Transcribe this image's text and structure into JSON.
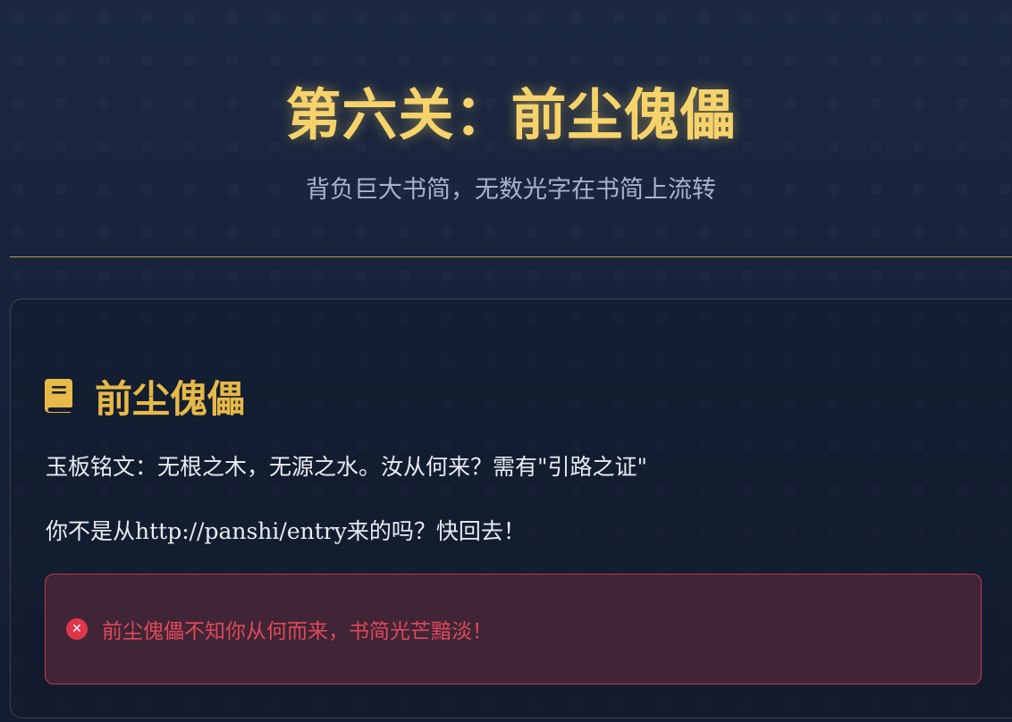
{
  "header": {
    "title": "第六关：前尘傀儡",
    "subtitle": "背负巨大书简，无数光字在书简上流转"
  },
  "card": {
    "icon": "book-icon",
    "title": "前尘傀儡",
    "inscription": "玉板铭文：无根之木，无源之水。汝从何来？需有\"引路之证\"",
    "hint": "你不是从http://panshi/entry来的吗？快回去！",
    "error": {
      "icon": "error-circle-icon",
      "message": "前尘傀儡不知你从何而来，书简光芒黯淡！"
    }
  },
  "colors": {
    "gold": "#f6d36a",
    "card_title": "#e6b948",
    "error": "#e0364c",
    "background": "#18243a"
  }
}
